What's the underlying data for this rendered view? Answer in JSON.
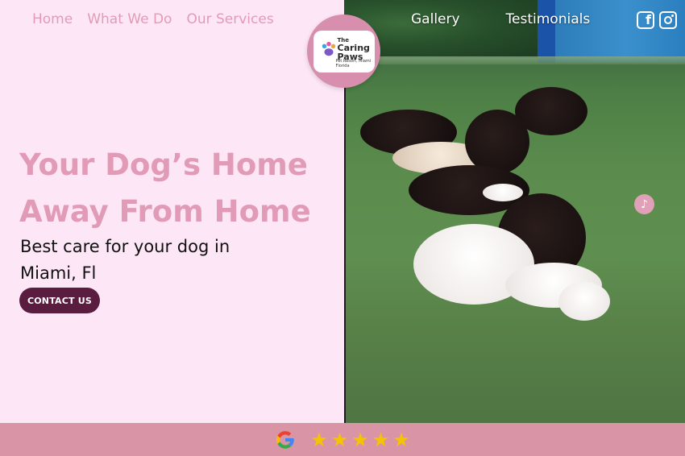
{
  "nav": {
    "left": [
      {
        "label": "Home"
      },
      {
        "label": "What We Do"
      },
      {
        "label": "Our Services"
      }
    ],
    "right": [
      {
        "label": "Gallery"
      },
      {
        "label": "Testimonials"
      }
    ]
  },
  "logo": {
    "line1": "The",
    "line2": "Caring",
    "line3": "Paws",
    "tagline": "Pet Resort, Miami Florida"
  },
  "hero": {
    "title_line1": "Your Dog’s Home",
    "title_line2": "Away From Home",
    "subtitle_line1": "Best care for your dog in",
    "subtitle_line2": "Miami, Fl",
    "cta_label": "CONTACT US"
  },
  "social": {
    "facebook_icon": "facebook-icon",
    "instagram_icon": "instagram-icon"
  },
  "footer": {
    "rating_source_icon": "google-icon",
    "stars": [
      "★",
      "★",
      "★",
      "★",
      "★"
    ]
  },
  "colors": {
    "background": "#fde6f6",
    "accent_pink": "#e29bb6",
    "button": "#5a1c3f",
    "footer": "#d995a6",
    "star": "#f5c400"
  }
}
